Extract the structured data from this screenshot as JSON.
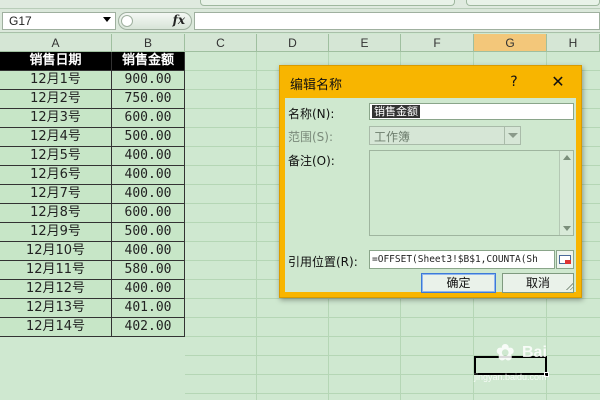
{
  "formula_bar": {
    "name_box": "G17",
    "fx_label": "fx"
  },
  "columns": [
    "A",
    "B",
    "C",
    "D",
    "E",
    "F",
    "G",
    "H"
  ],
  "selected_column": "G",
  "table": {
    "headers": [
      "销售日期",
      "销售金额"
    ],
    "rows": [
      [
        "12月1号",
        "900.00"
      ],
      [
        "12月2号",
        "750.00"
      ],
      [
        "12月3号",
        "600.00"
      ],
      [
        "12月4号",
        "500.00"
      ],
      [
        "12月5号",
        "400.00"
      ],
      [
        "12月6号",
        "400.00"
      ],
      [
        "12月7号",
        "400.00"
      ],
      [
        "12月8号",
        "600.00"
      ],
      [
        "12月9号",
        "500.00"
      ],
      [
        "12月10号",
        "400.00"
      ],
      [
        "12月11号",
        "580.00"
      ],
      [
        "12月12号",
        "400.00"
      ],
      [
        "12月13号",
        "401.00"
      ],
      [
        "12月14号",
        "402.00"
      ]
    ]
  },
  "dialog": {
    "title": "编辑名称",
    "help_label": "?",
    "close_label": "✕",
    "name_label": "名称(N):",
    "name_value": "销售金额",
    "scope_label": "范围(S):",
    "scope_value": "工作簿",
    "notes_label": "备注(O):",
    "ref_label": "引用位置(R):",
    "ref_value": "=OFFSET(Sheet3!$B$1,COUNTA(Sh",
    "ok_label": "确定",
    "cancel_label": "取消"
  },
  "watermark": {
    "brand": "Bai",
    "url": "jingyan.baidu.com"
  },
  "colors": {
    "sheet_background": "#cfe8d0",
    "dialog_title_bar": "#f8b500",
    "header_row_fill": "#000000",
    "selected_column_header": "#f3c77a"
  }
}
